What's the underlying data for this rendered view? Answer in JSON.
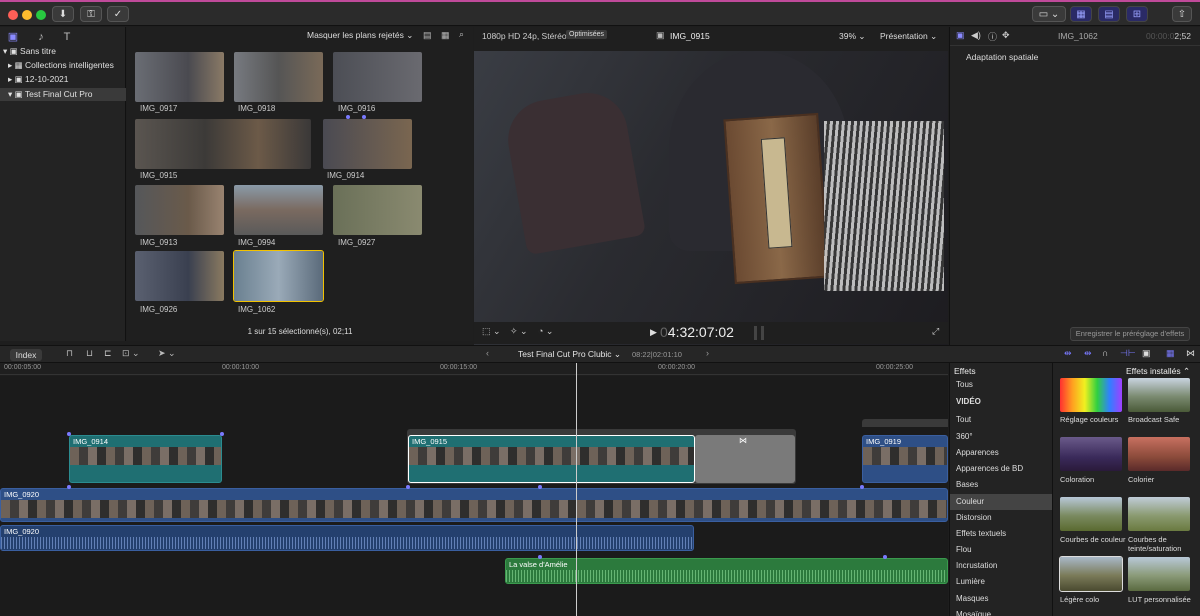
{
  "browser": {
    "filter_label": "Masquer les plans rejetés",
    "selection_status": "1 sur 15 sélectionné(s), 02;11",
    "clips": [
      {
        "name": "IMG_0917"
      },
      {
        "name": "IMG_0918"
      },
      {
        "name": "IMG_0916"
      },
      {
        "name": "IMG_0915"
      },
      {
        "name": "IMG_0914"
      },
      {
        "name": "IMG_0913"
      },
      {
        "name": "IMG_0994"
      },
      {
        "name": "IMG_0927"
      },
      {
        "name": "IMG_0926"
      },
      {
        "name": "IMG_1062"
      }
    ]
  },
  "library": {
    "items": [
      {
        "label": "Sans titre"
      },
      {
        "label": "Collections intelligentes"
      },
      {
        "label": "12-10-2021"
      },
      {
        "label": "Test Final Cut Pro"
      }
    ]
  },
  "viewer": {
    "format": "1080p HD 24p, Stéréo",
    "badge": "Optimisées",
    "clip_name": "IMG_0915",
    "zoom": "39%",
    "presentation": "Présentation",
    "timecode_dim": "0",
    "timecode": "4:32:07:02"
  },
  "inspector": {
    "clip_name": "IMG_1062",
    "duration_dim": "00:00:0",
    "duration": "2;52",
    "section": "Adaptation spatiale",
    "save_preset": "Enregistrer le préréglage d'effets"
  },
  "timeline": {
    "index_label": "Index",
    "project_name": "Test Final Cut Pro Clubic",
    "project_duration": "08:22|02:01:10",
    "ruler": [
      "00:00:05:00",
      "00:00:10:00",
      "00:00:15:00",
      "00:00:20:00",
      "00:00:25:00"
    ],
    "clips": {
      "c1": "IMG_0914",
      "c2": "IMG_0915",
      "c3": "IMG_0919",
      "main": "IMG_0920",
      "audio": "IMG_0920",
      "music": "La valse d'Amélie"
    }
  },
  "effects": {
    "title": "Effets",
    "installed": "Effets installés",
    "categories": [
      {
        "label": "Tous"
      },
      {
        "label": "VIDÉO"
      },
      {
        "label": "Tout"
      },
      {
        "label": "360°"
      },
      {
        "label": "Apparences"
      },
      {
        "label": "Apparences de BD"
      },
      {
        "label": "Bases"
      },
      {
        "label": "Couleur"
      },
      {
        "label": "Distorsion"
      },
      {
        "label": "Effets textuels"
      },
      {
        "label": "Flou"
      },
      {
        "label": "Incrustation"
      },
      {
        "label": "Lumière"
      },
      {
        "label": "Masques"
      },
      {
        "label": "Mosaïque"
      }
    ],
    "items": [
      {
        "label": "Réglage couleurs"
      },
      {
        "label": "Broadcast Safe"
      },
      {
        "label": "Coloration"
      },
      {
        "label": "Colorier"
      },
      {
        "label": "Courbes de couleur"
      },
      {
        "label": "Courbes de teinte/saturation"
      },
      {
        "label": "Légère colo"
      },
      {
        "label": "LUT personnalisée"
      }
    ]
  },
  "colors": {
    "accent": "#7a7aff",
    "selection": "#f2c200",
    "connected_clip": "#1f6f72",
    "primary_clip": "#2e4f86",
    "music_clip": "#2c7a3d"
  }
}
